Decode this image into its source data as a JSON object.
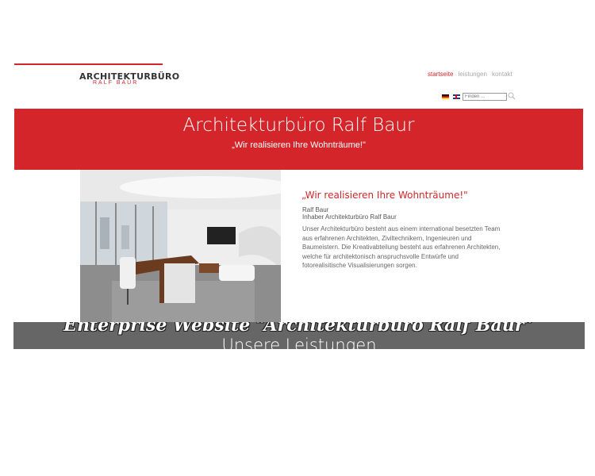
{
  "header": {
    "logo_title": "ARCHITEKTURBÜRO",
    "logo_subtitle": "RALF BAUR"
  },
  "nav": {
    "items": [
      "startseite",
      "leistungen",
      "kontakt"
    ],
    "active": "startseite"
  },
  "languages": [
    "de",
    "en"
  ],
  "search": {
    "placeholder": "Finden ..."
  },
  "banner": {
    "title": "Architekturbüro Ralf Baur",
    "subtitle": "„Wir realisieren Ihre Wohnträume!\""
  },
  "intro": {
    "quote": "„Wir realisieren Ihre Wohnträume!\"",
    "name": "Ralf Baur",
    "role": "Inhaber Architekturbüro Ralf Baur",
    "text": "Unser Architekturbüro besteht aus einem international besetzten Team aus erfahrenen Architekten, Ziviltechnikern, Ingenieuren und Baumeistern. Die Kreativabteilung besteht aus erfahrenen Architekten, welche für architektonisch anspruchsvolle Entwürfe und fotorealisitische Visualisierungen sorgen."
  },
  "overlay": {
    "caption": "Enterprise Website “Architekturbüro Ralf Baur”",
    "heading": "Unsere Leistungen"
  },
  "colors": {
    "accent": "#d4262a",
    "overlay": "#666666"
  }
}
